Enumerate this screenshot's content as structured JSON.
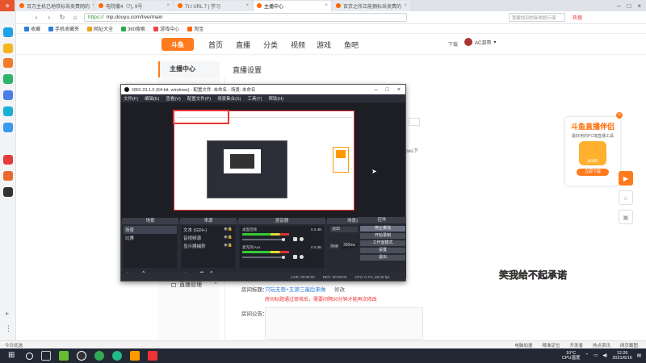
{
  "browser": {
    "tabs": [
      {
        "label": "百万主机已地铁标采卖费网的"
      },
      {
        "label": "电院撒4（7), 9号"
      },
      {
        "label": "Tt t URL 7 | 学习"
      },
      {
        "label": "主播中心"
      },
      {
        "label": "百京之所正能拥标采卖费的"
      }
    ],
    "url": "https://mp.douyu.com/live/main",
    "url_protocol": "https://",
    "url_path": "mp.douyu.com/live/main",
    "search_placeholder": "我要找到的新相机行家",
    "hot_label": "热搜",
    "bookmarks": [
      "收藏",
      "手机收藏夹",
      "网址大全",
      "360搜索",
      "游戏中心",
      "淘宝"
    ]
  },
  "douyu": {
    "logo_text": "斗鱼",
    "nav": [
      "首页",
      "直播",
      "分类",
      "视频",
      "游戏",
      "鱼吧"
    ],
    "download": "下载",
    "username": "AC游哥"
  },
  "page": {
    "center_title": "主播中心",
    "section_title": "直播设置",
    "live_mgmt": "直播管理",
    "live_title_label": "房间标题：",
    "live_title_value": "只玩无限+五源三遍后来做",
    "live_title_edit": "修改",
    "live_title_note": "房间标题通过审核后，需要间隔30分钟才能再次修改",
    "notice_label": "房间公告：",
    "fragment_text": "dows下"
  },
  "ad": {
    "title": "斗鱼直播伴侣",
    "subtitle": "最好用的PC端直播工具",
    "button": "立即下载",
    "badge": "pcdn"
  },
  "overlay": {
    "green_part": "笑我给",
    "purple_part": "不起承诺"
  },
  "obs": {
    "title": "OBS 23.1.0 (64-bit, windows) - 配置文件: 未命名 - 场景: 未命名",
    "menu": [
      "文件(F)",
      "编辑(E)",
      "查看(V)",
      "配置文件(P)",
      "场景集合(S)",
      "工具(T)",
      "帮助(H)"
    ],
    "docks": {
      "scenes": {
        "title": "场景",
        "items": [
          "场景",
          "比赛"
        ]
      },
      "sources": {
        "title": "来源",
        "items": [
          "文本 (GDI+)",
          "音视频源",
          "显示器捕获"
        ]
      },
      "mixer": {
        "title": "混音器",
        "channels": [
          {
            "name": "桌面音频",
            "db": "0.0 dB"
          },
          {
            "name": "麦克风/Aux",
            "db": "0.0 dB"
          }
        ]
      },
      "transitions": {
        "title": "场景过渡",
        "type": "淡出",
        "duration_label": "持续",
        "duration": "300ms"
      },
      "controls": {
        "title": "控件",
        "buttons": [
          "停止推流",
          "开始录制",
          "工作室模式",
          "设置",
          "退出"
        ]
      }
    },
    "status": {
      "live": "LIVE: 00:00:00",
      "rec": "REC: 00:00:00",
      "cpu": "CPU: 0.7%, 60.00 fps"
    }
  },
  "statusbar": {
    "left": "今日优选",
    "items": [
      "电脑加速",
      "精准定位",
      "开发者",
      "热点资讯",
      "网页截图"
    ]
  },
  "taskbar": {
    "weather": "10°C",
    "weather_sub": "CPU温度",
    "time": "12:26",
    "date": "2021/6/16"
  },
  "colors": {
    "accent": "#ff7b1e",
    "obs_bg": "#2b2e38",
    "taskbar": "#222935"
  }
}
